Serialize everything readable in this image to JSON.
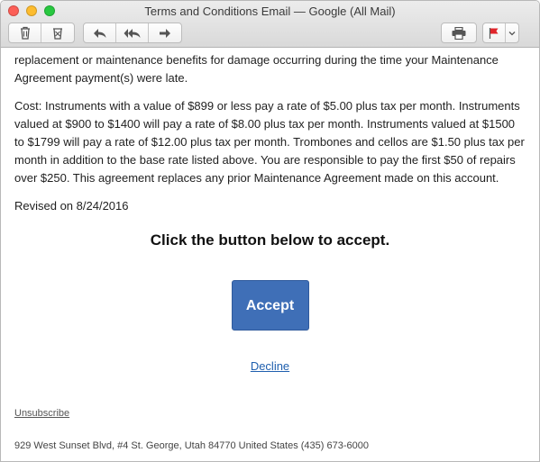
{
  "window": {
    "title": "Terms and Conditions Email — Google (All Mail)"
  },
  "toolbar": {
    "icons": [
      "trash-icon",
      "junk-icon",
      "reply-icon",
      "reply-all-icon",
      "forward-icon",
      "print-icon",
      "flag-icon",
      "chevron-down-icon"
    ],
    "flag_color": "#e0252b"
  },
  "email": {
    "paragraph_1": "replacement or maintenance benefits for damage occurring during the time your Maintenance Agreement payment(s) were late.",
    "paragraph_2": "Cost: Instruments with a value of $899 or less pay a rate of $5.00 plus tax per month. Instruments valued at $900 to $1400 will pay a rate of $8.00 plus tax per month. Instruments valued at $1500 to $1799 will pay a rate of $12.00 plus tax per month. Trombones and cellos are $1.50 plus tax per month in addition to the base rate listed above. You are responsible to pay the first $50 of repairs over $250. This agreement replaces any prior Maintenance Agreement made on this account.",
    "revised": "Revised on 8/24/2016",
    "headline": "Click the button below to accept.",
    "accept_label": "Accept",
    "decline_label": "Decline",
    "unsubscribe_label": "Unsubscribe",
    "address": "929 West Sunset Blvd, #4 St. George, Utah 84770 United States (435) 673-6000",
    "accent_color": "#3f6fb7"
  }
}
